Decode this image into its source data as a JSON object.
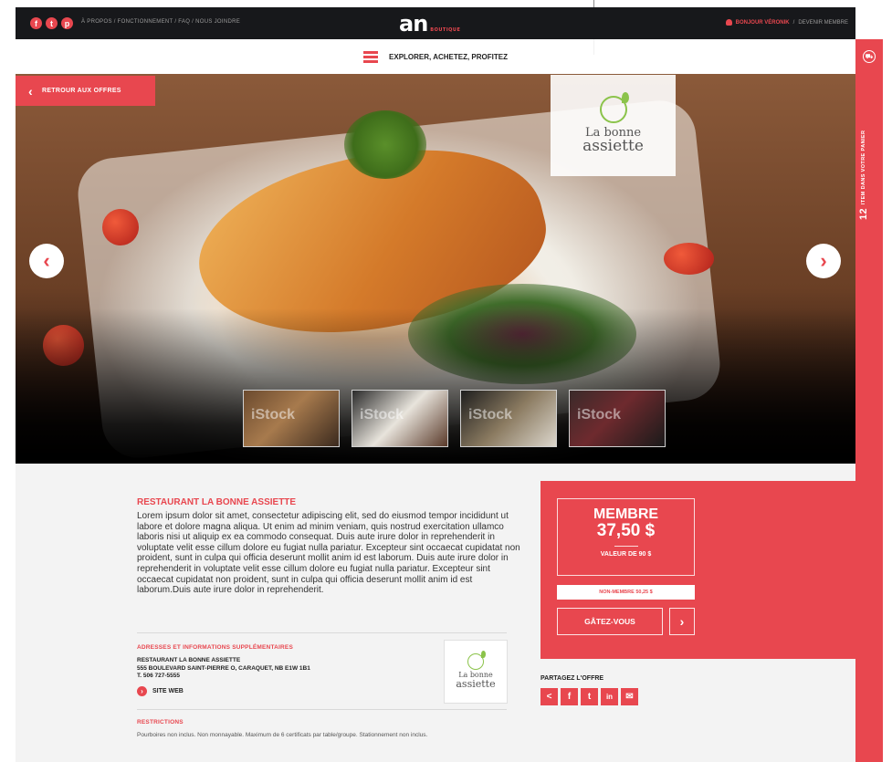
{
  "header": {
    "social": [
      {
        "icon": "facebook-icon",
        "glyph": "f"
      },
      {
        "icon": "twitter-icon",
        "glyph": "t"
      },
      {
        "icon": "pinterest-icon",
        "glyph": "p"
      }
    ],
    "links": "À PROPOS / FONCTIONNEMENT / FAQ / NOUS JOINDRE",
    "logo": "an",
    "logo_sub": "BOUTIQUE",
    "greeting": "BONJOUR VÉRONIK",
    "separator": "/",
    "become_member": "DEVENIR MEMBRE"
  },
  "nav": {
    "explore_label": "EXPLORER, ACHETEZ, PROFITEZ",
    "menu_icon": "hamburger-icon"
  },
  "hero": {
    "back_label": "RETROUR AUX OFFRES",
    "brand_line1": "La bonne",
    "brand_line2": "assiette",
    "prev_glyph": "‹",
    "next_glyph": "›",
    "thumb_watermark": "iStock",
    "thumbnails": 4
  },
  "cart": {
    "icon": "cart-icon",
    "count": "12",
    "label": "ITEM DANS VOTRE PANIER"
  },
  "offer": {
    "title": "RESTAURANT LA BONNE ASSIETTE",
    "description": "Lorem ipsum dolor sit amet, consectetur adipiscing elit, sed do eiusmod tempor incididunt ut labore et dolore magna aliqua. Ut enim ad minim veniam, quis nostrud exercitation ullamco laboris nisi ut aliquip ex ea commodo consequat. Duis aute irure dolor in reprehenderit in voluptate velit esse cillum dolore eu fugiat nulla pariatur. Excepteur sint occaecat cupidatat non proident, sunt in culpa qui officia deserunt mollit anim id est laborum. Duis aute irure dolor in reprehenderit in voluptate velit esse cillum dolore eu fugiat nulla pariatur. Excepteur sint occaecat cupidatat non proident, sunt in culpa qui officia deserunt mollit anim id est laborum.Duis aute irure dolor in reprehenderit.",
    "addresses_title": "ADRESSES ET INFORMATIONS SUPPLÉMENTAIRES",
    "address_name": "RESTAURANT LA BONNE ASSIETTE",
    "address_street": "555 BOULEVARD SAINT-PIERRE O, CARAQUET, NB E1W 1B1",
    "address_phone": "T. 506 727-5555",
    "site_label": "SITE WEB",
    "logo_line1": "La bonne",
    "logo_line2": "assiette",
    "restrictions_title": "RESTRICTIONS",
    "restrictions_text": "Pourboires non inclus. Non monnayable. Maximum de 6 certificats par table/groupe. Stationnement non inclus."
  },
  "price": {
    "member_label": "MEMBRE",
    "member_price": "37,50 $",
    "value_label": "VALEUR DE 90 $",
    "non_member": "NON-MEMBRE 50,25 $",
    "cta_label": "GÂTEZ-VOUS",
    "cta_arrow": "›"
  },
  "share": {
    "label": "PARTAGEZ L'OFFRE",
    "icons": [
      {
        "icon": "share-icon",
        "glyph": "<"
      },
      {
        "icon": "facebook-icon",
        "glyph": "f"
      },
      {
        "icon": "twitter-icon",
        "glyph": "t"
      },
      {
        "icon": "linkedin-icon",
        "glyph": "in"
      },
      {
        "icon": "email-icon",
        "glyph": "✉"
      }
    ]
  },
  "colors": {
    "accent": "#e8474f",
    "topbar": "#17181b",
    "panel_bg": "#f3f3f3"
  }
}
